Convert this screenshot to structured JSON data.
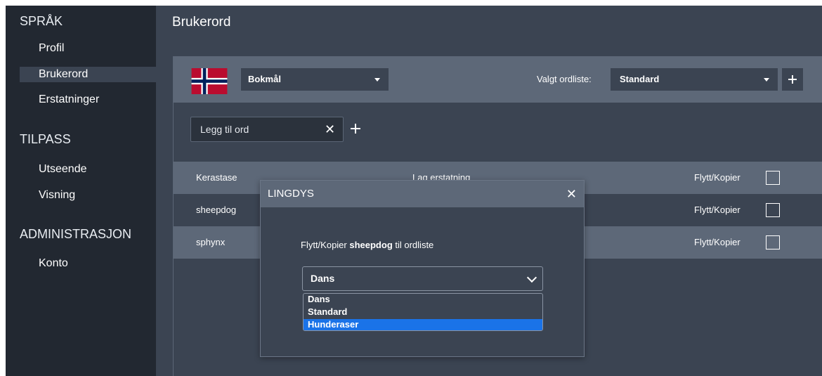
{
  "sidebar": {
    "sections": [
      {
        "heading": "SPRÅK",
        "items": [
          "Profil",
          "Brukerord",
          "Erstatninger"
        ]
      },
      {
        "heading": "TILPASS",
        "items": [
          "Utseende",
          "Visning"
        ]
      },
      {
        "heading": "ADMINISTRASJON",
        "items": [
          "Konto"
        ]
      }
    ],
    "active_item": "Brukerord"
  },
  "header": {
    "title": "Brukerord"
  },
  "toolbar": {
    "language": "Bokmål",
    "wordlist_label": "Valgt ordliste:",
    "wordlist_value": "Standard"
  },
  "add_word": {
    "placeholder": "Legg til ord",
    "clear": "✕"
  },
  "rows": [
    {
      "word": "Kerastase",
      "action": "Lag erstatning",
      "move": "Flytt/Kopier",
      "checked": false
    },
    {
      "word": "sheepdog",
      "action": "",
      "move": "Flytt/Kopier",
      "checked": false
    },
    {
      "word": "sphynx",
      "action": "",
      "move": "Flytt/Kopier",
      "checked": false
    }
  ],
  "modal": {
    "title": "LINGDYS",
    "close": "✕",
    "text_prefix": "Flytt/Kopier ",
    "text_word": "sheepdog",
    "text_suffix": " til ordliste",
    "select_value": "Dans",
    "options": [
      "Dans",
      "Standard",
      "Hunderaser"
    ],
    "highlighted_option": "Hunderaser"
  },
  "colors": {
    "sidebar_bg": "#222831",
    "main_bg": "#3b4452",
    "panel_light": "#5d6878",
    "highlight": "#1a73e8"
  },
  "icons": [
    "norway-flag-icon",
    "caret-down-icon",
    "plus-icon",
    "close-icon",
    "chevron-down-icon"
  ]
}
